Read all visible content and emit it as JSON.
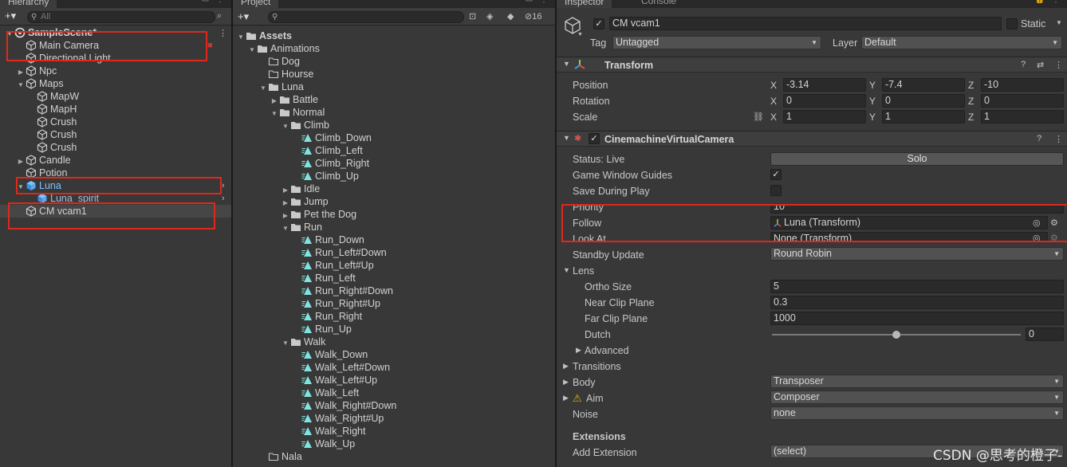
{
  "hierarchy": {
    "tab": "Hierarchy",
    "search_placeholder": "All",
    "items": [
      {
        "label": "SampleScene*",
        "indent": 0,
        "arrow": "down",
        "icon": "scene-icon"
      },
      {
        "label": "Main Camera",
        "indent": 1,
        "arrow": "",
        "icon": "gameobject-icon"
      },
      {
        "label": "Directional Light",
        "indent": 1,
        "arrow": "",
        "icon": "gameobject-icon"
      },
      {
        "label": "Npc",
        "indent": 1,
        "arrow": "right",
        "icon": "gameobject-icon"
      },
      {
        "label": "Maps",
        "indent": 1,
        "arrow": "down",
        "icon": "gameobject-icon"
      },
      {
        "label": "MapW",
        "indent": 2,
        "arrow": "",
        "icon": "gameobject-icon"
      },
      {
        "label": "MapH",
        "indent": 2,
        "arrow": "",
        "icon": "gameobject-icon"
      },
      {
        "label": "Crush",
        "indent": 2,
        "arrow": "",
        "icon": "gameobject-icon"
      },
      {
        "label": "Crush",
        "indent": 2,
        "arrow": "",
        "icon": "gameobject-icon"
      },
      {
        "label": "Crush",
        "indent": 2,
        "arrow": "",
        "icon": "gameobject-icon"
      },
      {
        "label": "Candle",
        "indent": 1,
        "arrow": "right",
        "icon": "gameobject-icon"
      },
      {
        "label": "Potion",
        "indent": 1,
        "arrow": "",
        "icon": "gameobject-icon"
      },
      {
        "label": "Luna",
        "indent": 1,
        "arrow": "down",
        "icon": "prefab-icon"
      },
      {
        "label": "Luna_spirit",
        "indent": 2,
        "arrow": "",
        "icon": "prefab-icon"
      },
      {
        "label": "CM vcam1",
        "indent": 1,
        "arrow": "",
        "icon": "gameobject-icon"
      }
    ]
  },
  "project": {
    "tab": "Project",
    "badge": "16",
    "items": [
      {
        "label": "Assets",
        "indent": 0,
        "arrow": "down",
        "kind": "folder",
        "bold": true
      },
      {
        "label": "Animations",
        "indent": 1,
        "arrow": "down",
        "kind": "folder"
      },
      {
        "label": "Dog",
        "indent": 2,
        "arrow": "",
        "kind": "folder-empty"
      },
      {
        "label": "Hourse",
        "indent": 2,
        "arrow": "",
        "kind": "folder-empty"
      },
      {
        "label": "Luna",
        "indent": 2,
        "arrow": "down",
        "kind": "folder"
      },
      {
        "label": "Battle",
        "indent": 3,
        "arrow": "right",
        "kind": "folder"
      },
      {
        "label": "Normal",
        "indent": 3,
        "arrow": "down",
        "kind": "folder"
      },
      {
        "label": "Climb",
        "indent": 4,
        "arrow": "down",
        "kind": "folder"
      },
      {
        "label": "Climb_Down",
        "indent": 5,
        "arrow": "",
        "kind": "anim"
      },
      {
        "label": "Climb_Left",
        "indent": 5,
        "arrow": "",
        "kind": "anim"
      },
      {
        "label": "Climb_Right",
        "indent": 5,
        "arrow": "",
        "kind": "anim"
      },
      {
        "label": "Climb_Up",
        "indent": 5,
        "arrow": "",
        "kind": "anim"
      },
      {
        "label": "Idle",
        "indent": 4,
        "arrow": "right",
        "kind": "folder"
      },
      {
        "label": "Jump",
        "indent": 4,
        "arrow": "right",
        "kind": "folder"
      },
      {
        "label": "Pet the Dog",
        "indent": 4,
        "arrow": "right",
        "kind": "folder"
      },
      {
        "label": "Run",
        "indent": 4,
        "arrow": "down",
        "kind": "folder"
      },
      {
        "label": "Run_Down",
        "indent": 5,
        "arrow": "",
        "kind": "anim"
      },
      {
        "label": "Run_Left#Down",
        "indent": 5,
        "arrow": "",
        "kind": "anim"
      },
      {
        "label": "Run_Left#Up",
        "indent": 5,
        "arrow": "",
        "kind": "anim"
      },
      {
        "label": "Run_Left",
        "indent": 5,
        "arrow": "",
        "kind": "anim"
      },
      {
        "label": "Run_Right#Down",
        "indent": 5,
        "arrow": "",
        "kind": "anim"
      },
      {
        "label": "Run_Right#Up",
        "indent": 5,
        "arrow": "",
        "kind": "anim"
      },
      {
        "label": "Run_Right",
        "indent": 5,
        "arrow": "",
        "kind": "anim"
      },
      {
        "label": "Run_Up",
        "indent": 5,
        "arrow": "",
        "kind": "anim"
      },
      {
        "label": "Walk",
        "indent": 4,
        "arrow": "down",
        "kind": "folder"
      },
      {
        "label": "Walk_Down",
        "indent": 5,
        "arrow": "",
        "kind": "anim"
      },
      {
        "label": "Walk_Left#Down",
        "indent": 5,
        "arrow": "",
        "kind": "anim"
      },
      {
        "label": "Walk_Left#Up",
        "indent": 5,
        "arrow": "",
        "kind": "anim"
      },
      {
        "label": "Walk_Left",
        "indent": 5,
        "arrow": "",
        "kind": "anim"
      },
      {
        "label": "Walk_Right#Down",
        "indent": 5,
        "arrow": "",
        "kind": "anim"
      },
      {
        "label": "Walk_Right#Up",
        "indent": 5,
        "arrow": "",
        "kind": "anim"
      },
      {
        "label": "Walk_Right",
        "indent": 5,
        "arrow": "",
        "kind": "anim"
      },
      {
        "label": "Walk_Up",
        "indent": 5,
        "arrow": "",
        "kind": "anim"
      },
      {
        "label": "Nala",
        "indent": 2,
        "arrow": "",
        "kind": "folder-empty"
      }
    ]
  },
  "inspector": {
    "tab": "Inspector",
    "tab2": "Console",
    "object_name": "CM vcam1",
    "static_label": "Static",
    "tag_label": "Tag",
    "tag_value": "Untagged",
    "layer_label": "Layer",
    "layer_value": "Default",
    "transform": {
      "title": "Transform",
      "position_label": "Position",
      "rotation_label": "Rotation",
      "scale_label": "Scale",
      "position": {
        "x": "-3.14",
        "y": "-7.4",
        "z": "-10"
      },
      "rotation": {
        "x": "0",
        "y": "0",
        "z": "0"
      },
      "scale": {
        "x": "1",
        "y": "1",
        "z": "1"
      }
    },
    "vcam": {
      "title": "CinemachineVirtualCamera",
      "status": "Status: Live",
      "solo": "Solo",
      "game_window_guides": "Game Window Guides",
      "save_during_play": "Save During Play",
      "priority_label": "Priority",
      "priority_value": "10",
      "follow_label": "Follow",
      "follow_value": "Luna (Transform)",
      "lookat_label": "Look At",
      "lookat_value": "None (Transform)",
      "standby_label": "Standby Update",
      "standby_value": "Round Robin",
      "lens_label": "Lens",
      "ortho_label": "Ortho Size",
      "ortho_value": "5",
      "near_label": "Near Clip Plane",
      "near_value": "0.3",
      "far_label": "Far Clip Plane",
      "far_value": "1000",
      "dutch_label": "Dutch",
      "dutch_value": "0",
      "advanced_label": "Advanced",
      "transitions_label": "Transitions",
      "body_label": "Body",
      "body_value": "Transposer",
      "aim_label": "Aim",
      "aim_value": "Composer",
      "noise_label": "Noise",
      "noise_value": "none",
      "extensions_label": "Extensions",
      "add_ext_label": "Add Extension",
      "add_ext_value": "(select)"
    },
    "watermark": "CSDN @思考的橙子-"
  },
  "colors": {
    "highlight_box": "#e0281a",
    "selection": "#2c5d87",
    "anim_icon": "#7fe3e0"
  }
}
